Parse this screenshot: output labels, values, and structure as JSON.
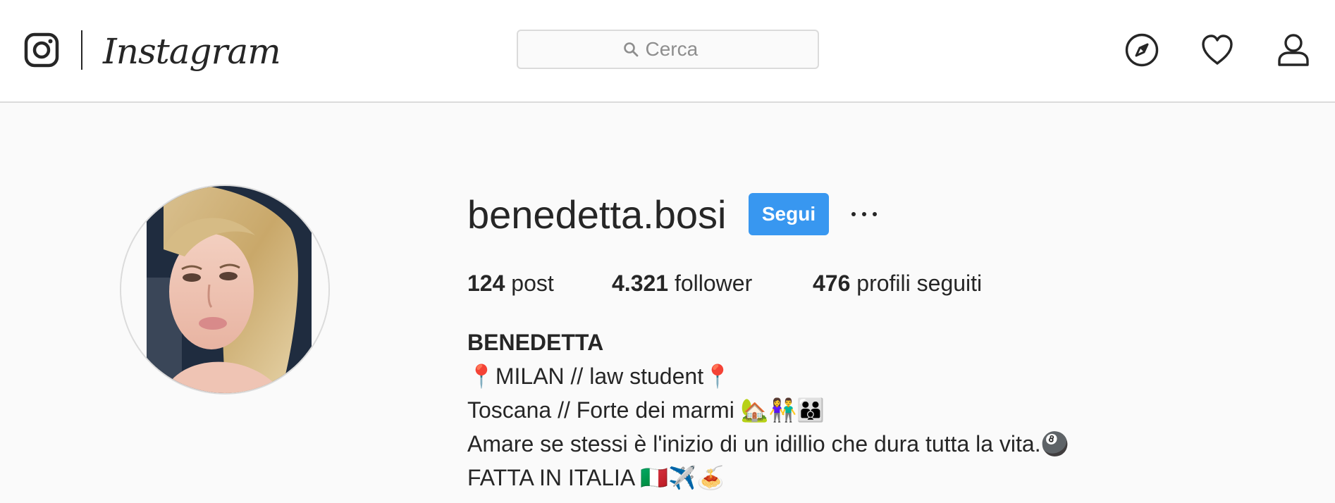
{
  "header": {
    "brand": "Instagram",
    "search_placeholder": "Cerca",
    "nav_icons": [
      "compass-icon",
      "heart-icon",
      "profile-icon"
    ]
  },
  "profile": {
    "username": "benedetta.bosi",
    "follow_label": "Segui",
    "more_label": "•••",
    "stats": {
      "posts_count": "124",
      "posts_label": "post",
      "followers_count": "4.321",
      "followers_label": "follower",
      "following_count": "476",
      "following_label": "profili seguiti"
    },
    "full_name": "BENEDETTA",
    "bio_lines": [
      "📍MILAN // law student📍",
      "Toscana // Forte dei marmi 🏡👫👪",
      "Amare se stessi è l'inizio di un idillio che dura tutta la vita.🎱",
      "FATTA IN ITALIA 🇮🇹✈️🍝"
    ]
  },
  "colors": {
    "accent": "#3897f0",
    "background": "#fafafa",
    "text": "#262626",
    "border": "#dbdbdb"
  }
}
